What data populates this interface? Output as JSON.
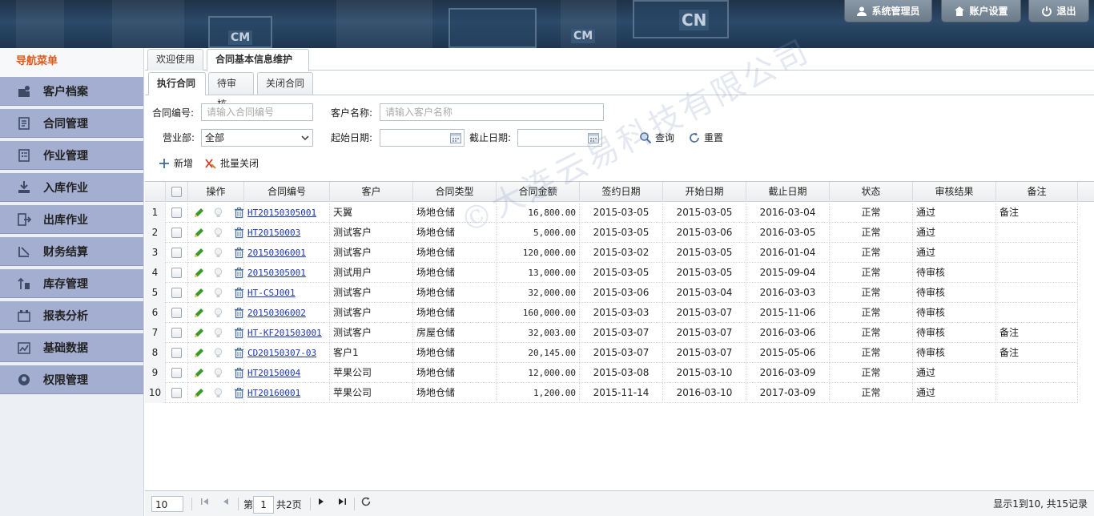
{
  "header": {
    "logo_marks": [
      "CN",
      "CM",
      "CM"
    ],
    "buttons": {
      "admin": "系统管理员",
      "account": "账户设置",
      "logout": "退出"
    }
  },
  "sidebar": {
    "title": "导航菜单",
    "items": [
      {
        "label": "客户档案",
        "icon": "customer-icon"
      },
      {
        "label": "合同管理",
        "icon": "contract-icon"
      },
      {
        "label": "作业管理",
        "icon": "task-icon"
      },
      {
        "label": "入库作业",
        "icon": "inbound-icon"
      },
      {
        "label": "出库作业",
        "icon": "outbound-icon"
      },
      {
        "label": "财务结算",
        "icon": "finance-icon"
      },
      {
        "label": "库存管理",
        "icon": "inventory-icon"
      },
      {
        "label": "报表分析",
        "icon": "report-icon"
      },
      {
        "label": "基础数据",
        "icon": "data-icon"
      },
      {
        "label": "权限管理",
        "icon": "permission-icon"
      }
    ]
  },
  "tabs": {
    "outer": [
      "欢迎使用",
      "合同基本信息维护"
    ],
    "close": "×",
    "inner": [
      "执行合同",
      "待审核",
      "关闭合同"
    ]
  },
  "form": {
    "contract_no_label": "合同编号:",
    "contract_no_placeholder": "请输入合同编号",
    "customer_label": "客户名称:",
    "customer_placeholder": "请输入客户名称",
    "dept_label": "营业部:",
    "dept_value": "全部",
    "start_label": "起始日期:",
    "end_label": "截止日期:",
    "query": "查询",
    "reset": "重置",
    "add": "新增",
    "batch_close": "批量关闭"
  },
  "table": {
    "headers": [
      "操作",
      "合同编号",
      "客户",
      "合同类型",
      "合同金额",
      "签约日期",
      "开始日期",
      "截止日期",
      "状态",
      "审核结果",
      "备注"
    ],
    "rows": [
      {
        "n": "1",
        "no": "HT20150305001",
        "cust": "天翼",
        "type": "场地仓储",
        "amt": "16,800.00",
        "sign": "2015-03-05",
        "start": "2015-03-05",
        "end": "2016-03-04",
        "status": "正常",
        "audit": "通过",
        "note": "备注"
      },
      {
        "n": "2",
        "no": "HT20150003",
        "cust": "测试客户",
        "type": "场地仓储",
        "amt": "5,000.00",
        "sign": "2015-03-05",
        "start": "2015-03-06",
        "end": "2016-03-05",
        "status": "正常",
        "audit": "通过",
        "note": ""
      },
      {
        "n": "3",
        "no": "20150306001",
        "cust": "测试客户",
        "type": "场地仓储",
        "amt": "120,000.00",
        "sign": "2015-03-02",
        "start": "2015-03-05",
        "end": "2016-01-04",
        "status": "正常",
        "audit": "通过",
        "note": ""
      },
      {
        "n": "4",
        "no": "20150305001",
        "cust": "测试用户",
        "type": "场地仓储",
        "amt": "13,000.00",
        "sign": "2015-03-05",
        "start": "2015-03-05",
        "end": "2015-09-04",
        "status": "正常",
        "audit": "待审核",
        "note": ""
      },
      {
        "n": "5",
        "no": "HT-CSJ001",
        "cust": "测试客户",
        "type": "场地仓储",
        "amt": "32,000.00",
        "sign": "2015-03-06",
        "start": "2015-03-04",
        "end": "2016-03-03",
        "status": "正常",
        "audit": "待审核",
        "note": ""
      },
      {
        "n": "6",
        "no": "20150306002",
        "cust": "测试客户",
        "type": "场地仓储",
        "amt": "160,000.00",
        "sign": "2015-03-03",
        "start": "2015-03-07",
        "end": "2015-11-06",
        "status": "正常",
        "audit": "待审核",
        "note": ""
      },
      {
        "n": "7",
        "no": "HT-KF201503001",
        "cust": "测试客户",
        "type": "房屋仓储",
        "amt": "32,003.00",
        "sign": "2015-03-07",
        "start": "2015-03-07",
        "end": "2016-03-06",
        "status": "正常",
        "audit": "待审核",
        "note": "备注"
      },
      {
        "n": "8",
        "no": "CD20150307-03",
        "cust": "客户1",
        "type": "场地仓储",
        "amt": "20,145.00",
        "sign": "2015-03-07",
        "start": "2015-03-07",
        "end": "2015-05-06",
        "status": "正常",
        "audit": "待审核",
        "note": "备注"
      },
      {
        "n": "9",
        "no": "HT20150004",
        "cust": "苹果公司",
        "type": "场地仓储",
        "amt": "12,000.00",
        "sign": "2015-03-08",
        "start": "2015-03-10",
        "end": "2016-03-09",
        "status": "正常",
        "audit": "通过",
        "note": ""
      },
      {
        "n": "10",
        "no": "HT20160001",
        "cust": "苹果公司",
        "type": "场地仓储",
        "amt": "1,200.00",
        "sign": "2015-11-14",
        "start": "2016-03-10",
        "end": "2017-03-09",
        "status": "正常",
        "audit": "通过",
        "note": ""
      }
    ]
  },
  "watermark": "©大连云易科技有限公司",
  "pager": {
    "page_size": "10",
    "page_prefix": "第",
    "page_current": "1",
    "page_suffix": "共2页",
    "summary": "显示1到10, 共15记录"
  },
  "colors": {
    "accent": "#e05a1c",
    "sidebar_item": "#a4aed0",
    "link": "#1a35b3"
  }
}
